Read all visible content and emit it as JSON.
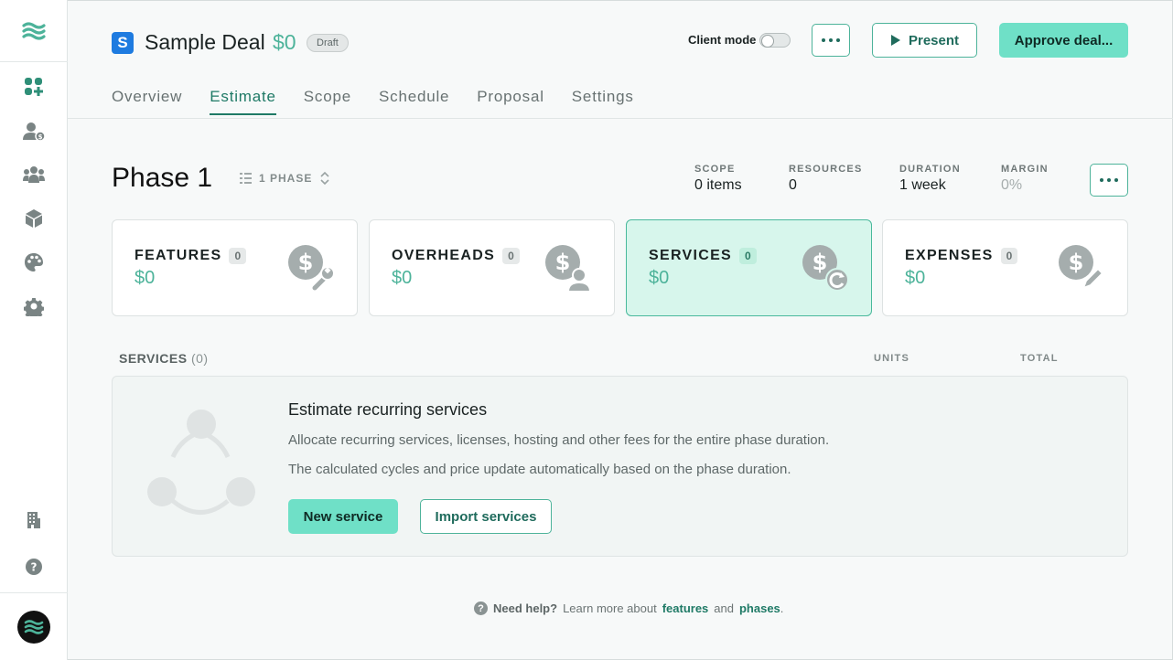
{
  "colors": {
    "accent": "#4db39a",
    "accent_light": "#6fe0c7",
    "brand_blue": "#1e7be0",
    "text_dark": "#1a2222"
  },
  "sidebar": {
    "items": [
      {
        "icon": "dashboard-add-icon"
      },
      {
        "icon": "user-dollar-icon"
      },
      {
        "icon": "team-icon"
      },
      {
        "icon": "cube-icon"
      },
      {
        "icon": "palette-icon"
      },
      {
        "icon": "gear-icon"
      },
      {
        "icon": "building-icon"
      },
      {
        "icon": "help-icon"
      }
    ]
  },
  "header": {
    "badge_letter": "S",
    "title": "Sample Deal",
    "amount": "$0",
    "status": "Draft",
    "client_mode_label": "Client mode",
    "present_label": "Present",
    "approve_label": "Approve deal...",
    "tabs": [
      {
        "label": "Overview"
      },
      {
        "label": "Estimate"
      },
      {
        "label": "Scope"
      },
      {
        "label": "Schedule"
      },
      {
        "label": "Proposal"
      },
      {
        "label": "Settings"
      }
    ],
    "active_tab": "Estimate"
  },
  "phase": {
    "title": "Phase 1",
    "selector_label": "1 PHASE",
    "stats": [
      {
        "label": "SCOPE",
        "value": "0 items"
      },
      {
        "label": "RESOURCES",
        "value": "0"
      },
      {
        "label": "DURATION",
        "value": "1 week"
      },
      {
        "label": "MARGIN",
        "value": "0%"
      }
    ]
  },
  "cards": [
    {
      "label": "FEATURES",
      "count": "0",
      "amount": "$0",
      "icon": "dollar-wrench-icon"
    },
    {
      "label": "OVERHEADS",
      "count": "0",
      "amount": "$0",
      "icon": "dollar-user-icon"
    },
    {
      "label": "SERVICES",
      "count": "0",
      "amount": "$0",
      "icon": "dollar-refresh-icon"
    },
    {
      "label": "EXPENSES",
      "count": "0",
      "amount": "$0",
      "icon": "dollar-pencil-icon"
    }
  ],
  "services": {
    "section_label": "SERVICES",
    "count": "(0)",
    "col_units": "UNITS",
    "col_total": "TOTAL",
    "empty_title": "Estimate recurring services",
    "empty_line1": "Allocate recurring services, licenses, hosting and other fees for the entire phase duration.",
    "empty_line2": "The calculated cycles and price update automatically based on the phase duration.",
    "new_label": "New service",
    "import_label": "Import services"
  },
  "help": {
    "lead": "Need help?",
    "text": "Learn more about",
    "link1": "features",
    "and": "and",
    "link2": "phases",
    "end": "."
  }
}
